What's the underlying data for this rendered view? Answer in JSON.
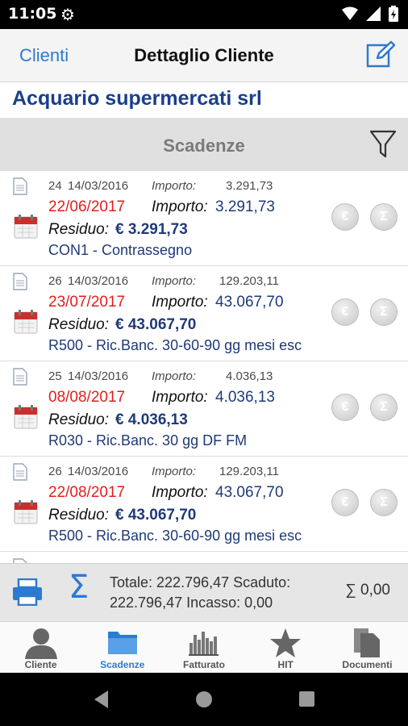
{
  "status": {
    "time": "11:05"
  },
  "nav": {
    "back_label": "Clienti",
    "title": "Dettaglio Cliente"
  },
  "client": {
    "name": "Acquario supermercati srl"
  },
  "section": {
    "title": "Scadenze"
  },
  "rows": [
    {
      "doc_num": "24",
      "doc_date": "14/03/2016",
      "doc_importo_label": "Importo:",
      "doc_importo": "3.291,73",
      "due_date": "22/06/2017",
      "due_importo_label": "Importo:",
      "due_importo": "3.291,73",
      "residuo_label": "Residuo:",
      "residuo": "€ 3.291,73",
      "payment": "CON1 - Contrassegno"
    },
    {
      "doc_num": "26",
      "doc_date": "14/03/2016",
      "doc_importo_label": "Importo:",
      "doc_importo": "129.203,11",
      "due_date": "23/07/2017",
      "due_importo_label": "Importo:",
      "due_importo": "43.067,70",
      "residuo_label": "Residuo:",
      "residuo": "€ 43.067,70",
      "payment": "R500 - Ric.Banc. 30-60-90 gg mesi esc"
    },
    {
      "doc_num": "25",
      "doc_date": "14/03/2016",
      "doc_importo_label": "Importo:",
      "doc_importo": "4.036,13",
      "due_date": "08/08/2017",
      "due_importo_label": "Importo:",
      "due_importo": "4.036,13",
      "residuo_label": "Residuo:",
      "residuo": "€ 4.036,13",
      "payment": "R030 - Ric.Banc. 30 gg DF FM"
    },
    {
      "doc_num": "26",
      "doc_date": "14/03/2016",
      "doc_importo_label": "Importo:",
      "doc_importo": "129.203,11",
      "due_date": "22/08/2017",
      "due_importo_label": "Importo:",
      "due_importo": "43.067,70",
      "residuo_label": "Residuo:",
      "residuo": "€ 43.067,70",
      "payment": "R500 - Ric.Banc. 30-60-90 gg mesi esc"
    }
  ],
  "summary": {
    "line1": "Totale: 222.796,47  Scaduto:",
    "line2": "222.796,47  Incasso: 0,00",
    "sum": "∑ 0,00"
  },
  "tabs": [
    {
      "label": "Cliente",
      "icon": "person-icon",
      "active": false
    },
    {
      "label": "Scadenze",
      "icon": "folder-icon",
      "active": true
    },
    {
      "label": "Fatturato",
      "icon": "bar-chart-icon",
      "active": false
    },
    {
      "label": "HIT",
      "icon": "star-icon",
      "active": false
    },
    {
      "label": "Documenti",
      "icon": "documents-icon",
      "active": false
    }
  ],
  "colors": {
    "accent": "#2c7bd1",
    "due_red": "#e0201e",
    "value_blue": "#1f3a78",
    "client_blue": "#1a3f8c"
  }
}
